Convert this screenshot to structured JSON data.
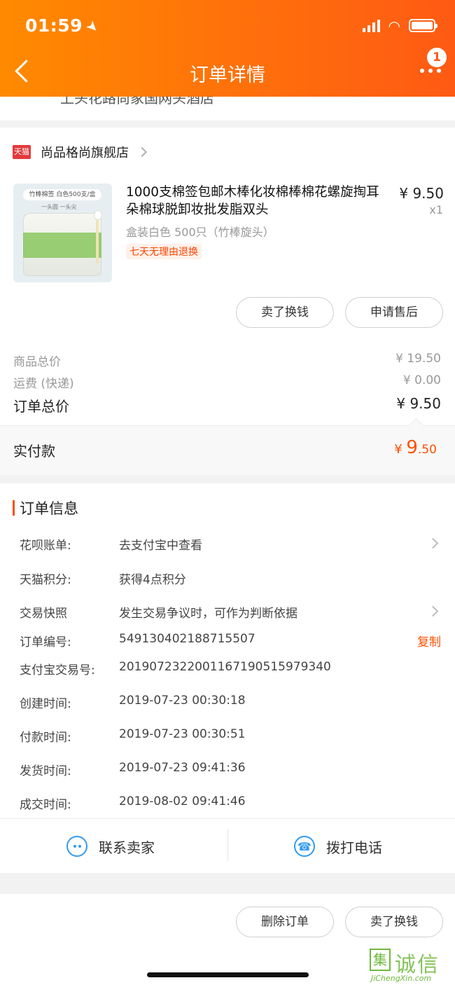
{
  "status_bar": {
    "time": "01:59"
  },
  "header": {
    "title": "订单详情",
    "badge_count": "1"
  },
  "cut_off_text": "上头花路尚家国网头酒店",
  "shop": {
    "logo_text": "天猫",
    "name": "尚品格尚旗舰店"
  },
  "product": {
    "thumb_label": "竹棒棉签 白色500支/盒",
    "thumb_sub": "一头圆 一头尖",
    "title": "1000支棉签包邮木棒化妆棉棒棉花螺旋掏耳朵棉球脱卸妆批发脂双头",
    "price": "¥ 9.50",
    "qty": "x1",
    "spec": "盒装白色 500只（竹棒旋头）",
    "tag": "七天无理由退换"
  },
  "actions": {
    "sell": "卖了换钱",
    "after_sale": "申请售后"
  },
  "prices": {
    "goods_label": "商品总价",
    "goods_value": "¥ 19.50",
    "shipping_label": "运费 (快递)",
    "shipping_value": "¥ 0.00",
    "total_label": "订单总价",
    "total_value": "¥ 9.50"
  },
  "paid": {
    "label": "实付款",
    "currency": "¥ ",
    "integer": "9",
    "decimal": ".50"
  },
  "order_info": {
    "title": "订单信息",
    "rows": [
      {
        "label": "花呗账单:",
        "value": "去支付宝中查看"
      },
      {
        "label": "天猫积分:",
        "value": "获得4点积分"
      },
      {
        "label": "交易快照",
        "value": "发生交易争议时，可作为判断依据"
      },
      {
        "label": "订单编号:",
        "value": "549130402188715507"
      },
      {
        "label": "支付宝交易号:",
        "value": "2019072322001167190515979340"
      },
      {
        "label": "创建时间:",
        "value": "2019-07-23 00:30:18"
      },
      {
        "label": "付款时间:",
        "value": "2019-07-23 00:30:51"
      },
      {
        "label": "发货时间:",
        "value": "2019-07-23 09:41:36"
      },
      {
        "label": "成交时间:",
        "value": "2019-08-02 09:41:46"
      }
    ],
    "copy_label": "复制"
  },
  "contact": {
    "seller": "联系卖家",
    "phone": "拨打电话"
  },
  "bottom_actions": {
    "delete": "删除订单",
    "sell": "卖了换钱"
  },
  "watermark": {
    "char": "集",
    "text": "诚信",
    "url": "JiChengXin.com"
  }
}
